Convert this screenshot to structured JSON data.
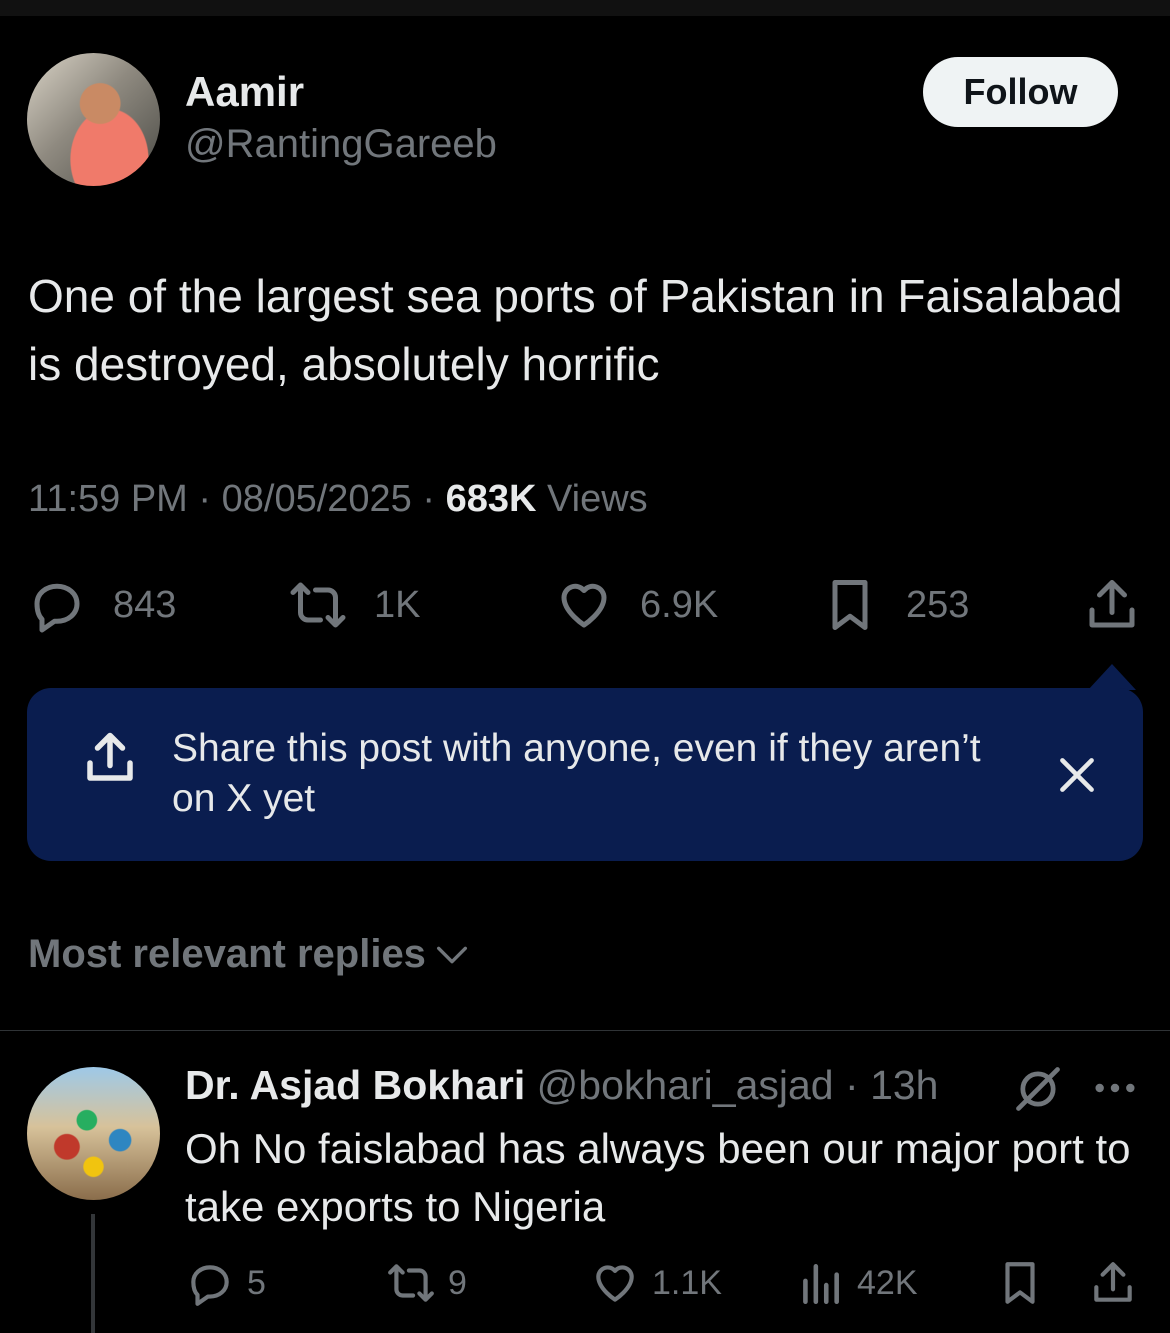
{
  "post": {
    "author_name": "Aamir",
    "author_handle": "@RantingGareeb",
    "follow_label": "Follow",
    "text": "One of the largest sea ports of Pakistan in Faisalabad is destroyed, absolutely horrific",
    "time": "11:59 PM",
    "date": "08/05/2025",
    "separator": "·",
    "views_count": "683K",
    "views_label": "Views",
    "actions": {
      "replies": "843",
      "reposts": "1K",
      "likes": "6.9K",
      "bookmarks": "253"
    }
  },
  "tooltip": {
    "text": "Share this post with anyone, even if they aren’t on X yet"
  },
  "replies_sort": {
    "label": "Most relevant replies"
  },
  "reply": {
    "author_name": "Dr. Asjad Bokhari",
    "author_handle": "@bokhari_asjad",
    "separator": "·",
    "time": "13h",
    "text": "Oh No faislabad has always been our major port to take exports to Nigeria",
    "actions": {
      "replies": "5",
      "reposts": "9",
      "likes": "1.1K",
      "views": "42K"
    }
  },
  "colors": {
    "background": "#000000",
    "text_primary": "#e7e9ea",
    "text_secondary": "#71767b",
    "tooltip_bg": "#0a1d4f",
    "follow_bg": "#eff3f4"
  }
}
